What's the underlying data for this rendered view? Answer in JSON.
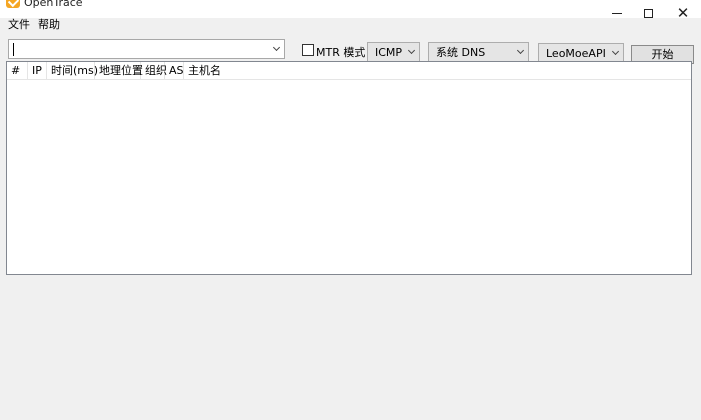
{
  "window": {
    "title": "OpenTrace",
    "minimize_glyph": "",
    "maximize_glyph": "",
    "close_glyph": "✕"
  },
  "menu": {
    "file": "文件",
    "help": "帮助"
  },
  "toolbar": {
    "host_value": "",
    "mtr_label": "MTR 模式",
    "mtr_checked": false,
    "protocol": "ICMP",
    "dns": "系统 DNS",
    "geo_api": "LeoMoeAPI",
    "start_label": "开始"
  },
  "table": {
    "columns": [
      "#",
      "IP",
      "时间(ms)",
      "地理位置",
      "组织",
      "AS",
      "主机名"
    ],
    "rows": []
  }
}
